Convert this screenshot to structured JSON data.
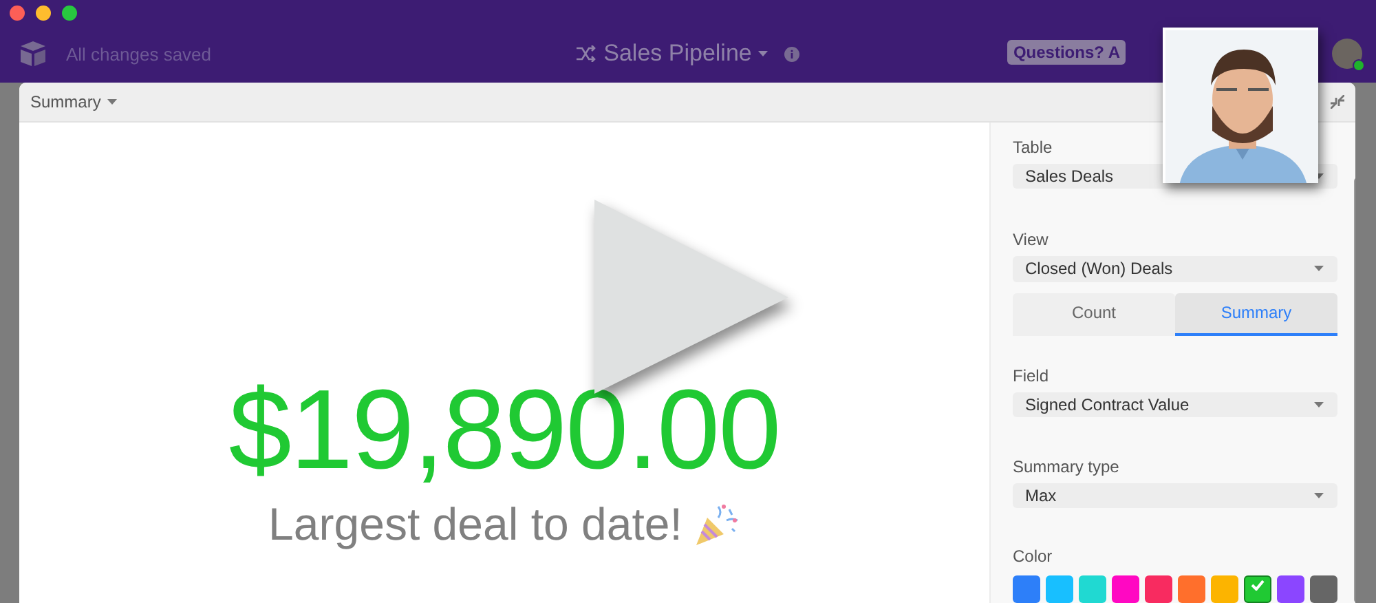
{
  "header": {
    "save_status": "All changes saved",
    "base_name": "Sales Pipeline",
    "help_button": "Questions? A",
    "user_online": true
  },
  "block": {
    "title": "Summary",
    "value": "$19,890.00",
    "caption": "Largest deal to date!"
  },
  "settings": {
    "table": {
      "label": "Table",
      "value": "Sales Deals"
    },
    "view": {
      "label": "View",
      "value": "Closed (Won) Deals"
    },
    "tabs": [
      {
        "label": "Count",
        "selected": false
      },
      {
        "label": "Summary",
        "selected": true
      }
    ],
    "field": {
      "label": "Field",
      "value": "Signed Contract Value"
    },
    "summary_type": {
      "label": "Summary type",
      "value": "Max"
    },
    "color": {
      "label": "Color",
      "swatches": [
        {
          "color": "#2d7ff9",
          "selected": false
        },
        {
          "color": "#18bfff",
          "selected": false
        },
        {
          "color": "#20d9d2",
          "selected": false
        },
        {
          "color": "#ff08c2",
          "selected": false
        },
        {
          "color": "#f82b60",
          "selected": false
        },
        {
          "color": "#ff6f2c",
          "selected": false
        },
        {
          "color": "#fcb400",
          "selected": false
        },
        {
          "color": "#20c933",
          "selected": true
        },
        {
          "color": "#8b46ff",
          "selected": false
        },
        {
          "color": "#666666",
          "selected": false
        }
      ]
    }
  }
}
